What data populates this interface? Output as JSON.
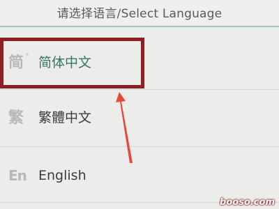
{
  "header": {
    "title": "请选择语言/Select Language"
  },
  "languages": [
    {
      "icon_text": "简",
      "label": "简体中文",
      "selected": true
    },
    {
      "icon_text": "繁",
      "label": "繁體中文",
      "selected": false
    },
    {
      "icon_text": "En",
      "label": "English",
      "selected": false
    }
  ],
  "annotation": {
    "highlight_color": "#8a1f24",
    "arrow_color": "#e8473a"
  },
  "watermark": "booso.com",
  "colors": {
    "selected_text": "#2f7a62",
    "divider_accent": "#9dc6cf"
  }
}
